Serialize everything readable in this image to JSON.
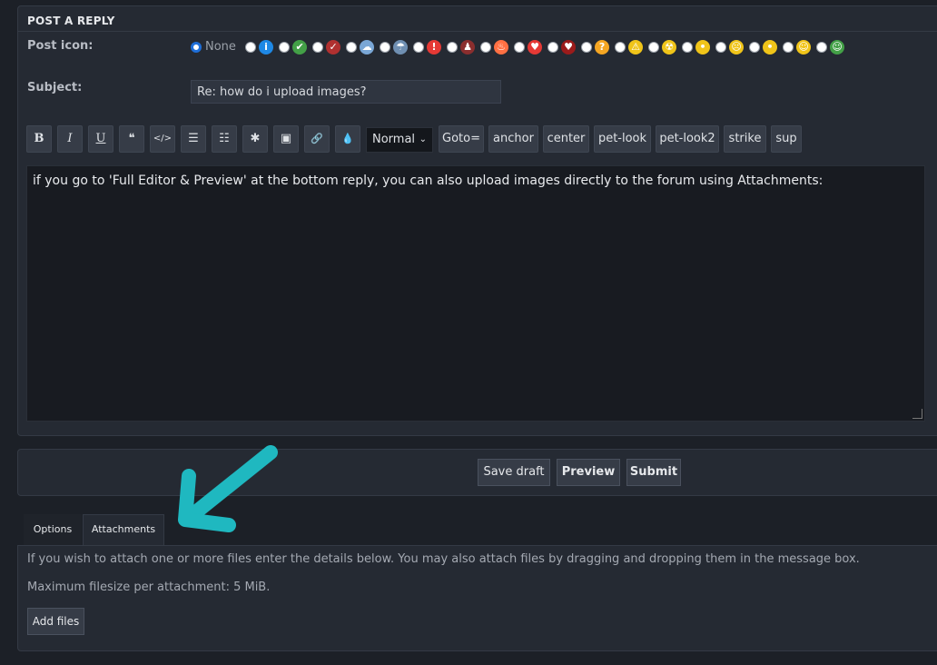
{
  "panel": {
    "title": "POST A REPLY",
    "post_icon_label": "Post icon:",
    "subject_label": "Subject:"
  },
  "icons": {
    "none_label": "None",
    "items": [
      {
        "name": "info-icon",
        "color": "#1e88e5",
        "glyph": "i"
      },
      {
        "name": "check-icon",
        "color": "#43a047",
        "glyph": "✔"
      },
      {
        "name": "broom-icon",
        "color": "#b03030",
        "glyph": "✓"
      },
      {
        "name": "cloud-icon",
        "color": "#7aa7d6",
        "glyph": "☁"
      },
      {
        "name": "rain-cloud-icon",
        "color": "#6f8fb2",
        "glyph": "☂"
      },
      {
        "name": "exclamation-icon",
        "color": "#e53935",
        "glyph": "!"
      },
      {
        "name": "figure-icon",
        "color": "#8b2e2e",
        "glyph": "♟"
      },
      {
        "name": "fire-icon",
        "color": "#ff7043",
        "glyph": "♨"
      },
      {
        "name": "heart-icon",
        "color": "#e53935",
        "glyph": "♥"
      },
      {
        "name": "heart-dark-icon",
        "color": "#9b1b1b",
        "glyph": "♥"
      },
      {
        "name": "question-icon",
        "color": "#f5a623",
        "glyph": "?"
      },
      {
        "name": "warning-icon",
        "color": "#f0c419",
        "glyph": "⚠"
      },
      {
        "name": "radiation-icon",
        "color": "#f0c419",
        "glyph": "☢"
      },
      {
        "name": "smiley-neutral-icon",
        "color": "#f0c419",
        "glyph": "•"
      },
      {
        "name": "smiley-sad-icon",
        "color": "#f0c419",
        "glyph": "☹"
      },
      {
        "name": "smiley-rolleyes-icon",
        "color": "#f0c419",
        "glyph": "•"
      },
      {
        "name": "smiley-happy-icon",
        "color": "#f0c419",
        "glyph": "☺"
      },
      {
        "name": "smiley-grin-green-icon",
        "color": "#43a047",
        "glyph": "☺"
      }
    ]
  },
  "subject": {
    "value": "Re: how do i upload images?"
  },
  "toolbar": {
    "bold": "B",
    "italic": "I",
    "underline": "U",
    "quote": "❝",
    "code": "</>",
    "list": "☰",
    "list_ordered": "☷",
    "asterisk": "✱",
    "image": "▣",
    "link": "🔗",
    "color": "💧",
    "size_value": "Normal",
    "goto": "Goto=",
    "anchor": "anchor",
    "center": "center",
    "pet_look": "pet-look",
    "pet_look2": "pet-look2",
    "strike": "strike",
    "sup": "sup"
  },
  "editor": {
    "text": "if you go to 'Full Editor & Preview' at the bottom reply, you can also upload images directly to the forum using Attachments:"
  },
  "actions": {
    "save_draft": "Save draft",
    "preview": "Preview",
    "submit": "Submit"
  },
  "tabs": {
    "options": "Options",
    "attachments": "Attachments"
  },
  "attachments": {
    "info": "If you wish to attach one or more files enter the details below. You may also attach files by dragging and dropping them in the message box.",
    "max_size": "Maximum filesize per attachment: 5 MiB.",
    "add_files": "Add files"
  },
  "colors": {
    "annotation_arrow": "#1fb8c0",
    "accent": "#1e6ed8"
  }
}
